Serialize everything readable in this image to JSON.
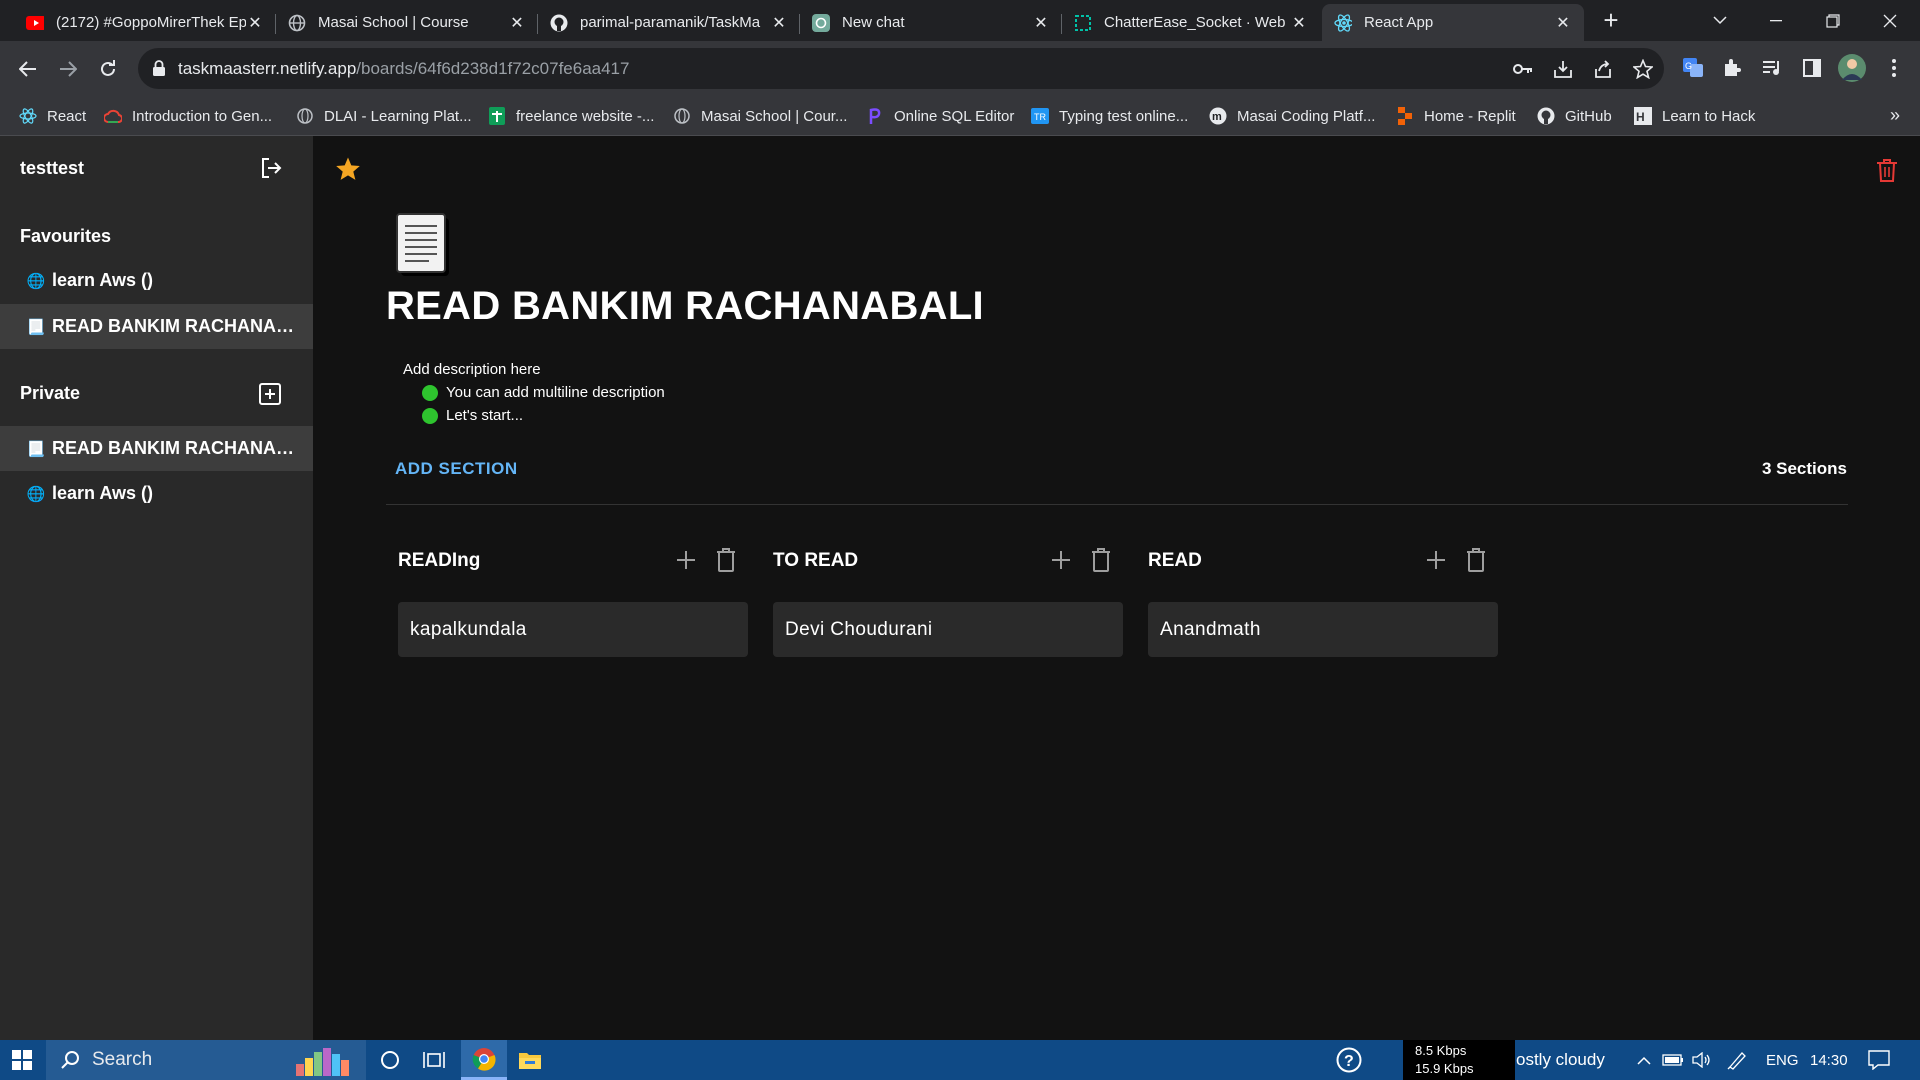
{
  "browser": {
    "tabs": [
      {
        "title": "(2172) #GoppoMirerThek Ep",
        "icon": "youtube-icon"
      },
      {
        "title": "Masai School | Course",
        "icon": "globe-icon"
      },
      {
        "title": "parimal-paramanik/TaskMa",
        "icon": "github-icon"
      },
      {
        "title": "New chat",
        "icon": "chatgpt-icon"
      },
      {
        "title": "ChatterEase_Socket · Web S",
        "icon": "replit-icon"
      },
      {
        "title": "React App",
        "icon": "react-icon",
        "active": true
      }
    ],
    "url_host": "taskmaasterr.netlify.app",
    "url_path": "/boards/64f6d238d1f72c07fe6aa417",
    "bookmarks": [
      {
        "label": "React"
      },
      {
        "label": "Introduction to Gen..."
      },
      {
        "label": "DLAI - Learning Plat..."
      },
      {
        "label": "freelance website -..."
      },
      {
        "label": "Masai School | Cour..."
      },
      {
        "label": "Online SQL Editor"
      },
      {
        "label": "Typing test online..."
      },
      {
        "label": "Masai Coding Platf..."
      },
      {
        "label": "Home - Replit"
      },
      {
        "label": "GitHub"
      },
      {
        "label": "Learn to Hack"
      }
    ],
    "bookmarks_more": "»"
  },
  "sidebar": {
    "username": "testtest",
    "favourites_heading": "Favourites",
    "favourites": [
      {
        "icon": "🌐",
        "label": "learn Aws ()"
      },
      {
        "icon": "📃",
        "label": "READ BANKIM RACHANABALI",
        "selected": true
      }
    ],
    "private_heading": "Private",
    "private": [
      {
        "icon": "📃",
        "label": "READ BANKIM RACHANABALI",
        "selected": true
      },
      {
        "icon": "🌐",
        "label": "learn Aws ()"
      }
    ]
  },
  "board": {
    "title": "READ BANKIM RACHANABALI",
    "description_lead": "Add description here",
    "description_items": [
      "You can add multiline description",
      "Let's start..."
    ],
    "add_section_label": "ADD SECTION",
    "sections_count": "3 Sections",
    "sections": [
      {
        "title": "READIng",
        "cards": [
          "kapalkundala"
        ]
      },
      {
        "title": "TO READ",
        "cards": [
          "Devi Choudurani"
        ]
      },
      {
        "title": "READ",
        "cards": [
          "Anandmath"
        ]
      }
    ]
  },
  "taskbar": {
    "search_placeholder": "Search",
    "net_up": "8.5 Kbps",
    "net_down": "15.9 Kbps",
    "weather": "ostly cloudy",
    "language": "ENG",
    "time": "14:30"
  }
}
